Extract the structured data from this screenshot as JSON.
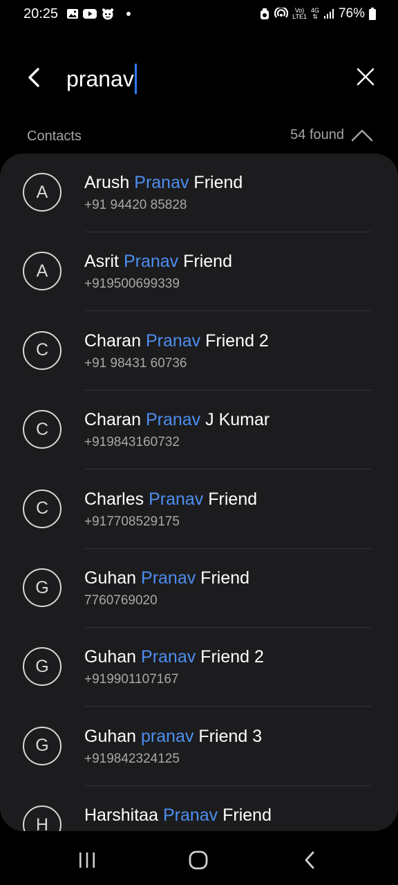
{
  "status_bar": {
    "time": "20:25",
    "battery": "76%",
    "network_4g": "4G",
    "volte_line1": "Vo)",
    "volte_line2": "LTE1",
    "left_icons": [
      "gallery-icon",
      "youtube-icon",
      "app-icon",
      "dot-icon"
    ],
    "right_icons": [
      "alarm-icon",
      "hotspot-icon",
      "volte-icon",
      "4g-icon",
      "signal-icon",
      "battery-icon"
    ]
  },
  "search": {
    "query": "pranav"
  },
  "section": {
    "title": "Contacts",
    "found": "54 found"
  },
  "colors": {
    "accent": "#4d8ef0",
    "card_bg": "#1c1c1e",
    "cursor": "#2f7df6"
  },
  "contacts": [
    {
      "initial": "A",
      "name_pre": "Arush ",
      "name_match": "Pranav",
      "name_post": " Friend",
      "phone": "+91 94420 85828"
    },
    {
      "initial": "A",
      "name_pre": "Asrit ",
      "name_match": "Pranav",
      "name_post": " Friend",
      "phone": "+919500699339"
    },
    {
      "initial": "C",
      "name_pre": "Charan ",
      "name_match": "Pranav",
      "name_post": " Friend 2",
      "phone": "+91 98431 60736"
    },
    {
      "initial": "C",
      "name_pre": "Charan ",
      "name_match": "Pranav",
      "name_post": " J Kumar",
      "phone": "+919843160732"
    },
    {
      "initial": "C",
      "name_pre": "Charles ",
      "name_match": "Pranav",
      "name_post": " Friend",
      "phone": "+917708529175"
    },
    {
      "initial": "G",
      "name_pre": "Guhan ",
      "name_match": "Pranav",
      "name_post": " Friend",
      "phone": "7760769020"
    },
    {
      "initial": "G",
      "name_pre": "Guhan ",
      "name_match": "Pranav",
      "name_post": " Friend 2",
      "phone": "+919901107167"
    },
    {
      "initial": "G",
      "name_pre": "Guhan ",
      "name_match": "pranav",
      "name_post": " Friend 3",
      "phone": "+919842324125"
    },
    {
      "initial": "H",
      "name_pre": "Harshitaa ",
      "name_match": "Pranav",
      "name_post": " Friend",
      "phone": ""
    }
  ],
  "nav": {
    "icons": [
      "recents-icon",
      "home-icon",
      "back-nav-icon"
    ]
  }
}
